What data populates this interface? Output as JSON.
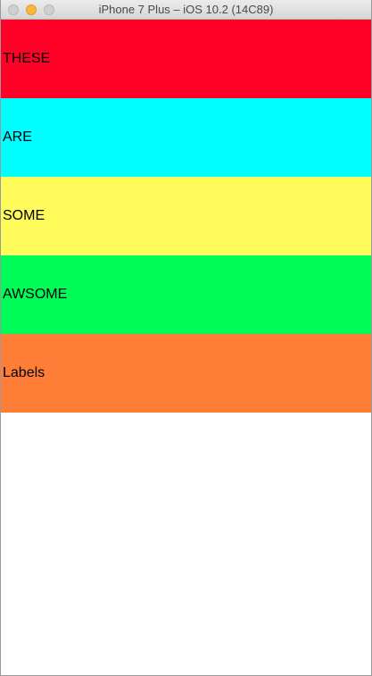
{
  "window": {
    "title": "iPhone 7 Plus – iOS 10.2 (14C89)"
  },
  "labels": [
    {
      "text": "THESE",
      "color": "#ff0026"
    },
    {
      "text": "ARE",
      "color": "#00ffff"
    },
    {
      "text": "SOME",
      "color": "#fffb5a"
    },
    {
      "text": "AWSOME",
      "color": "#00fc57"
    },
    {
      "text": "Labels",
      "color": "#fe7e38"
    }
  ]
}
